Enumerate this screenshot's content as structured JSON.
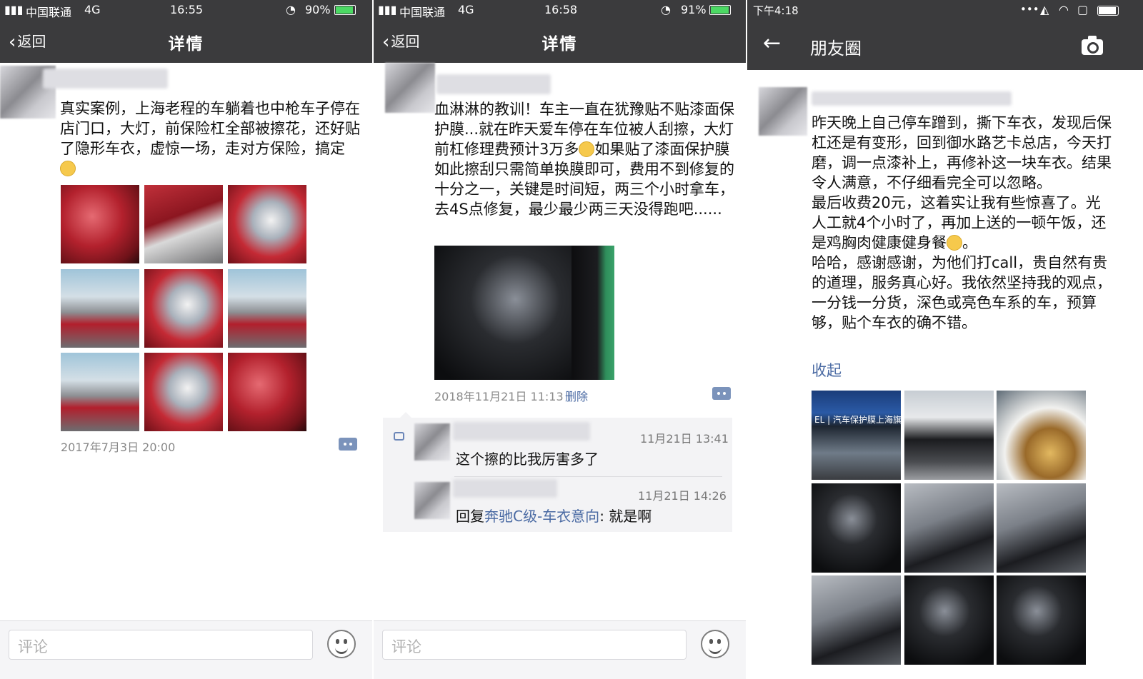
{
  "panel1": {
    "status": {
      "carrier": "中国联通",
      "network": "4G",
      "time": "16:55",
      "battery": "90%"
    },
    "nav": {
      "back_label": "返回",
      "title": "详情"
    },
    "post": {
      "text": "真实案例，上海老程的车躺着也中枪车子停在店门口，大灯，前保险杠全部被擦花，还好贴了隐形车衣，虚惊一场，走对方保险，搞定",
      "time": "2017年7月3日 20:00"
    },
    "footer": {
      "placeholder": "评论"
    }
  },
  "panel2": {
    "status": {
      "carrier": "中国联通",
      "network": "4G",
      "time": "16:58",
      "battery": "91%"
    },
    "nav": {
      "back_label": "返回",
      "title": "详情"
    },
    "post": {
      "text": "血淋淋的教训！车主一直在犹豫贴不贴漆面保护膜...就在昨天爱车停在车位被人刮擦，大灯前杠修理费预计3万多",
      "text2": "如果贴了漆面保护膜如此擦刮只需简单换膜即可，费用不到修复的十分之一，关键是时间短，两三个小时拿车，去4S点修复，最少最少两三天没得跑吧......",
      "time": "2018年11月21日 11:13",
      "delete_label": "删除"
    },
    "comments": [
      {
        "time": "11月21日 13:41",
        "text": "这个擦的比我厉害多了"
      },
      {
        "time": "11月21日 14:26",
        "reply_prefix": "回复",
        "reply_to": "奔驰C级-车衣意向",
        "text": ": 就是啊"
      }
    ],
    "footer": {
      "placeholder": "评论"
    }
  },
  "panel3": {
    "status": {
      "time": "下午4:18"
    },
    "nav": {
      "title": "朋友圈"
    },
    "post": {
      "para1": "昨天晚上自己停车蹭到，撕下车衣，发现后保杠还是有变形，回到御水路艺卡总店，今天打磨，调一点漆补上，再修补这一块车衣。结果令人满意，不仔细看完全可以忽略。",
      "para2a": "最后收费20元，这着实让我有些惊喜了。光人工就4个小时了，再加上送的一顿午饭，还是鸡胸肉健康健身餐",
      "para2b": "。",
      "para3": "哈哈，感谢感谢，为他们打call，贵自然有贵的道理，服务真心好。我依然坚持我的观点，一分钱一分货，深色或亮色车系的车，预算够，贴个车衣的确不错。",
      "collapse_label": "收起",
      "shop_sign": "EL | 汽车保护膜上海旗"
    }
  }
}
